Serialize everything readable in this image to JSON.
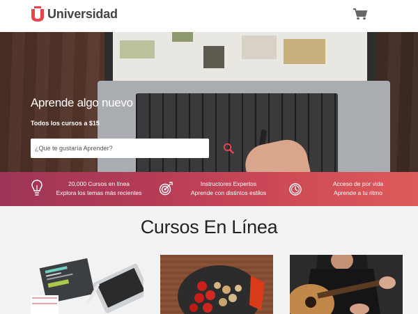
{
  "header": {
    "logo_text": "Universidad",
    "brand_color": "#e8434f",
    "cart_icon": "cart-icon"
  },
  "hero": {
    "title": "Aprende algo nuevo",
    "subtitle": "Todos los cursos a $15",
    "search_placeholder": "¿Que te gustaría Aprender?",
    "search_icon": "search-icon"
  },
  "features": [
    {
      "icon": "lightbulb-icon",
      "line1": "20,000 Cursos en línea",
      "line2": "Explora los temas más recientes"
    },
    {
      "icon": "target-icon",
      "line1": "Instructores Expertos",
      "line2": "Aprende con distintos estilos"
    },
    {
      "icon": "clock-icon",
      "line1": "Acceso de por vida",
      "line2": "Aprende a tu ritmo"
    }
  ],
  "section": {
    "title": "Cursos En Línea"
  },
  "cards": [
    {
      "image": "desk-notebook-laptop"
    },
    {
      "image": "food-pan-vegetables"
    },
    {
      "image": "guitar-player"
    }
  ],
  "colors": {
    "band_start": "#9e3556",
    "band_end": "#df5a5a",
    "header_bg": "#ffffff",
    "page_bg": "#f3f3f3"
  }
}
